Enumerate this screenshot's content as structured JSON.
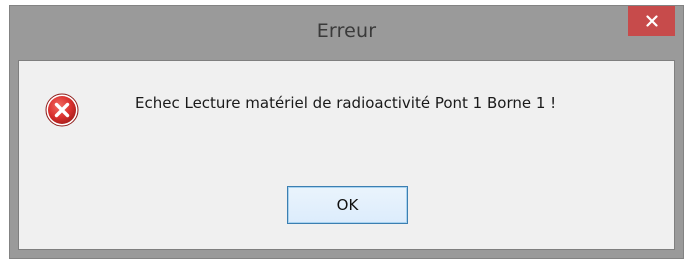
{
  "dialog": {
    "title": "Erreur",
    "message": "Echec Lecture matériel de radioactivité Pont 1 Borne 1 !",
    "icon": "error-icon",
    "close_icon": "close-icon",
    "ok_label": "OK"
  },
  "colors": {
    "frame": "#9a9a9a",
    "close_button": "#c74b4b",
    "client_background": "#f0f0f0",
    "ok_border": "#3c7fb1",
    "error_icon": "#d9302e"
  }
}
